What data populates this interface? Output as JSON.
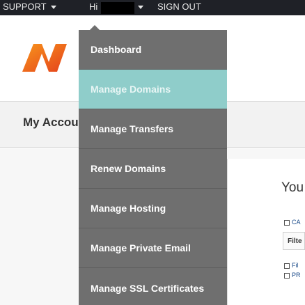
{
  "topbar": {
    "support_label": "SUPPORT",
    "greeting": "Hi",
    "signout_label": "SIGN OUT"
  },
  "page": {
    "title": "My Accou",
    "panel_heading": "You",
    "side_links": [
      "CA",
      "Filte",
      "Fil",
      "PR"
    ]
  },
  "menu": {
    "items": [
      {
        "label": "Dashboard"
      },
      {
        "label": "Manage Domains"
      },
      {
        "label": "Manage Transfers"
      },
      {
        "label": "Renew Domains"
      },
      {
        "label": "Manage Hosting"
      },
      {
        "label": "Manage Private Email"
      },
      {
        "label": "Manage SSL Certificates"
      }
    ]
  },
  "colors": {
    "topbar": "#1f2127",
    "menu_bg": "#6f6f6f",
    "menu_active": "#8fcdca",
    "logo_orange": "#f26b21"
  }
}
